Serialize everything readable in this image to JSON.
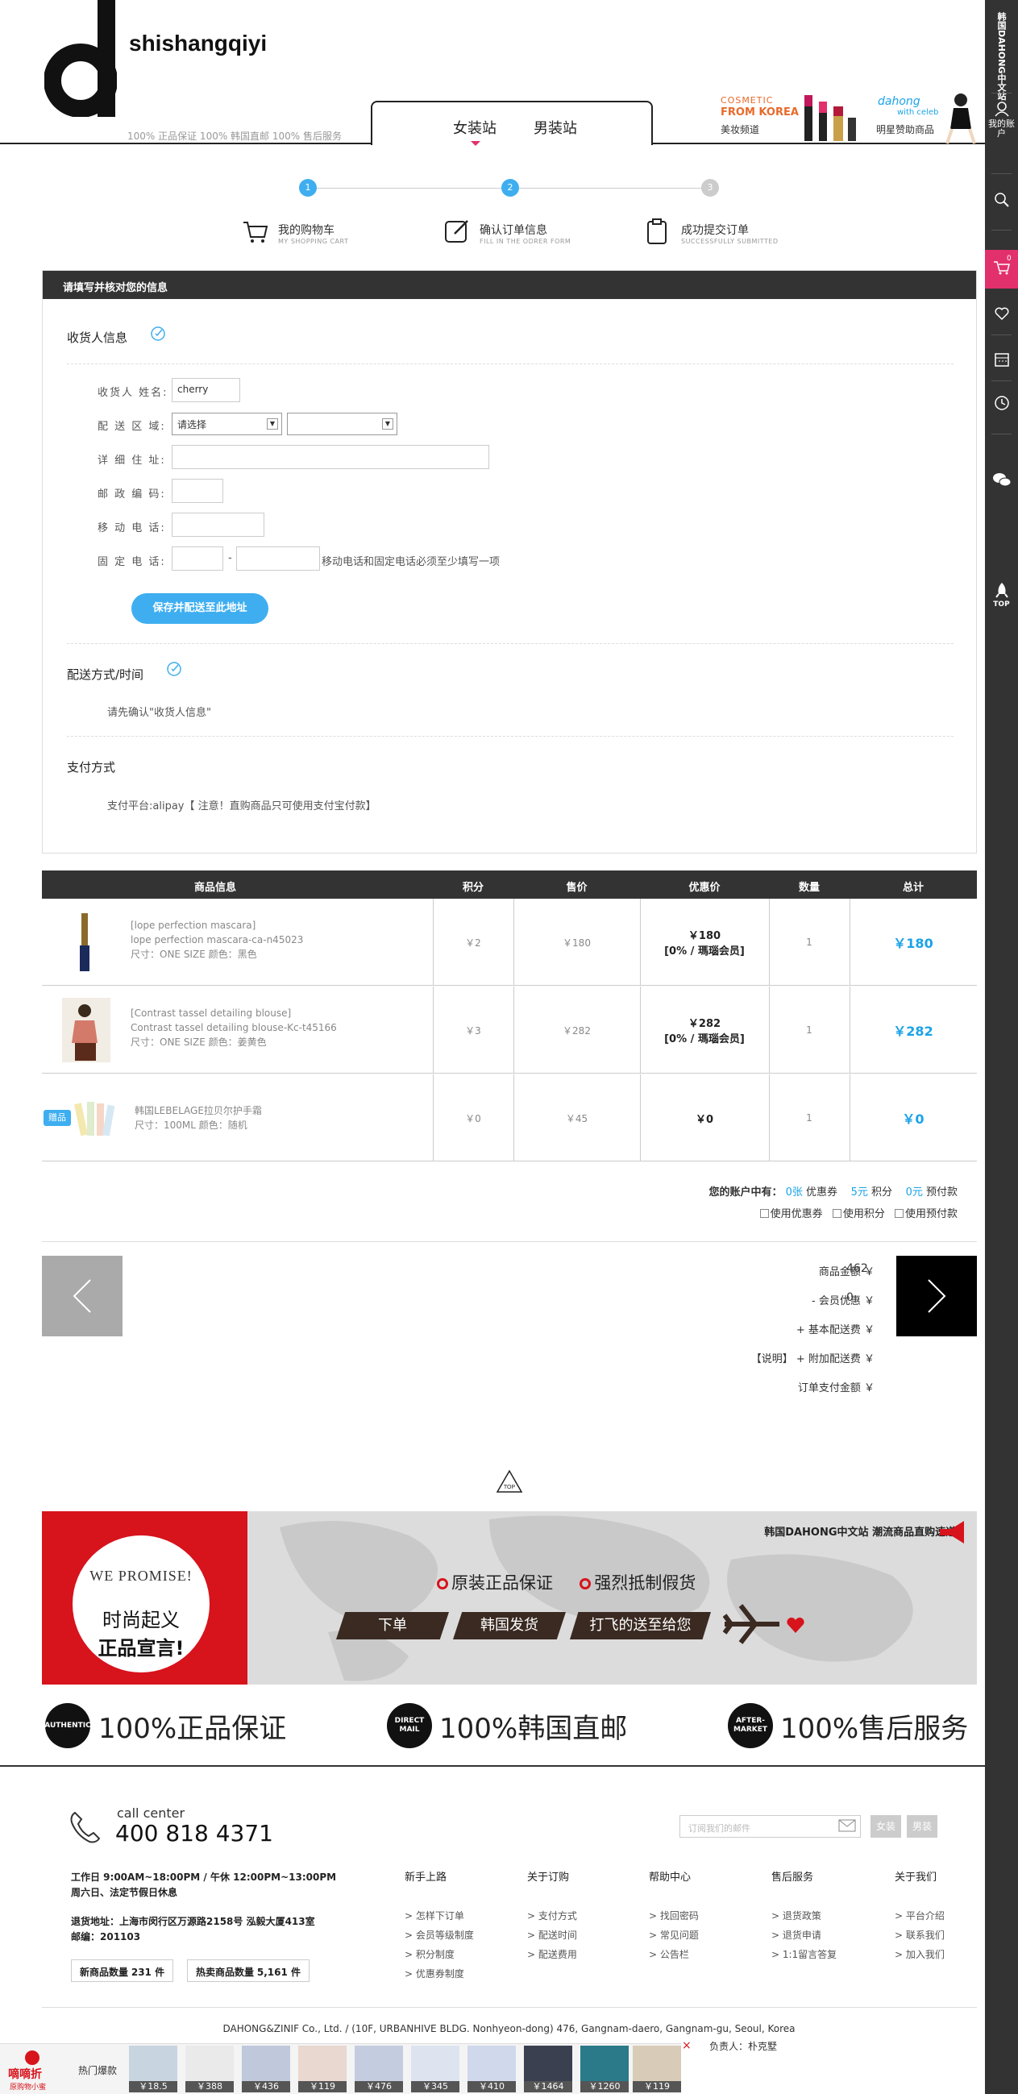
{
  "header": {
    "brand": "shishangqiyi",
    "slogan": "100% 正品保证  100% 韩国直邮  100% 售后服务",
    "tabs": [
      "女装站",
      "男装站"
    ],
    "promo1": {
      "line1": "COSMETIC",
      "line2": "FROM KOREA",
      "line3": "美妆频道"
    },
    "promo2": {
      "line1": "dahong",
      "line2": "with celeb",
      "line3": "明星赞助商品"
    }
  },
  "sidebar": {
    "site_name": "韩国DAHONG中文站",
    "account": "我的账户",
    "cart_count": "0",
    "top": "TOP"
  },
  "steps": [
    {
      "num": "1",
      "label": "我的购物车",
      "sub": "MY SHOPPING CART"
    },
    {
      "num": "2",
      "label": "确认订单信息",
      "sub": "FILL IN THE ODRER FORM"
    },
    {
      "num": "3",
      "label": "成功提交订单",
      "sub": "SUCCESSFULLY SUBMITTED"
    }
  ],
  "form": {
    "panel_title": "请填写并核对您的信息",
    "section_receiver": "收货人信息",
    "name_label": "收货人 姓名:",
    "name_value": "cherry",
    "area_label": "配 送 区 域:",
    "area_select": "请选择",
    "addr_label": "详 细 住 址:",
    "zip_label": "邮 政 编 码:",
    "mobile_label": "移 动 电 话:",
    "phone_label": "固 定 电 话:",
    "phone_dash": "-",
    "phone_note": "移动电话和固定电话必须至少填写一项",
    "save_button": "保存并配送至此地址",
    "section_delivery": "配送方式/时间",
    "delivery_note": "请先确认\"收货人信息\"",
    "section_payment": "支付方式",
    "payment_note": "支付平台:alipay【 注意！直购商品只可使用支付宝付款】"
  },
  "table": {
    "headers": [
      "商品信息",
      "积分",
      "售价",
      "优惠价",
      "数量",
      "总计"
    ],
    "rows": [
      {
        "name1": "[lope perfection mascara]",
        "name2": "lope perfection mascara-ca-n45023",
        "attrs": "尺寸：ONE SIZE    颜色：黑色",
        "points": "￥2",
        "price": "￥180",
        "discount": "￥180",
        "member": "[0% / 瑪瑙会员]",
        "qty": "1",
        "total": "￥180"
      },
      {
        "name1": "[Contrast tassel detailing blouse]",
        "name2": "Contrast tassel detailing blouse-Kc-t45166",
        "attrs": "尺寸：ONE SIZE    颜色：姜黄色",
        "points": "￥3",
        "price": "￥282",
        "discount": "￥282",
        "member": "[0% / 瑪瑙会员]",
        "qty": "1",
        "total": "￥282"
      },
      {
        "badge": "赠品",
        "name1": "韩国LEBELAGE拉贝尔护手霜",
        "attrs": "尺寸：100ML    颜色：随机",
        "points": "￥0",
        "price": "￥45",
        "discount": "￥0",
        "qty": "1",
        "total": "￥0"
      }
    ]
  },
  "account": {
    "prefix": "您的账户中有：",
    "coupon_n": "0张",
    "coupon": "优惠券",
    "points_n": "5元",
    "points": "积分",
    "prepay_n": "0元",
    "prepay": "预付款",
    "opt1": "使用优惠券",
    "opt2": "使用积分",
    "opt3": "使用预付款"
  },
  "summary": {
    "goods_label": "商品金额  ￥",
    "goods_value": "462",
    "member_label": "- 会员优惠  ￥",
    "member_value": "0",
    "base_label": "+ 基本配送费  ￥",
    "extra_label": "【说明】 + 附加配送费  ￥",
    "pay_label": "订单支付金额  ￥"
  },
  "banner": {
    "promise1": "WE PROMISE!",
    "promise2": "时尚起义",
    "promise3": "正品宣言!",
    "point1": "原装正品保证",
    "point2": "强烈抵制假货",
    "step1": "下单",
    "step2": "韩国发货",
    "step3": "打飞的送至给您",
    "tag": "韩国DAHONG中文站  潮流商品直购速递!",
    "top": "TOP"
  },
  "guarantees": [
    {
      "badge": "AUTHENTIC",
      "text": "100%正品保证"
    },
    {
      "badge": "DIRECT MAIL",
      "text": "100%韩国直邮"
    },
    {
      "badge": "AFTER-MARKET",
      "text": "100%售后服务"
    }
  ],
  "footer": {
    "cc_label": "call center",
    "cc_number": "400 818 4371",
    "email_placeholder": "订阅我们的邮件",
    "btn_women": "女装",
    "btn_men": "男装",
    "hours1": "工作日 9:00AM~18:00PM / 午休 12:00PM~13:00PM",
    "hours2": "周六日、法定节假日休息",
    "addr1": "退货地址：上海市闵行区万源路2158号 泓毅大厦413室",
    "addr2": "邮编：201103",
    "new_label": "新商品数量",
    "new_count": "231 件",
    "hot_label": "热卖商品数量",
    "hot_count": "5,161 件",
    "columns": [
      {
        "title": "新手上路",
        "items": [
          "> 怎样下订单",
          "> 会员等级制度",
          "> 积分制度",
          "> 优惠券制度"
        ]
      },
      {
        "title": "关于订购",
        "items": [
          "> 支付方式",
          "> 配送时间",
          "> 配送费用"
        ]
      },
      {
        "title": "帮助中心",
        "items": [
          "> 找回密码",
          "> 常见问题",
          "> 公告栏"
        ]
      },
      {
        "title": "售后服务",
        "items": [
          "> 退货政策",
          "> 退货申请",
          "> 1:1留言答复"
        ]
      },
      {
        "title": "关于我们",
        "items": [
          "> 平台介绍",
          "> 联系我们",
          "> 加入我们"
        ]
      }
    ],
    "copyright": "DAHONG&ZINIF Co., Ltd. / (10F, URBANHIVE BLDG. Nonhyeon-dong) 476, Gangnam-daero, Gangnam-gu, Seoul, Korea",
    "owner": "负责人：朴克墅"
  },
  "bottom_bar": {
    "logo": "嘀嘀折",
    "logo_sub": "原购物小蜜",
    "label": "热门爆款",
    "close": "×",
    "prices": [
      "￥18.5",
      "￥388",
      "￥436",
      "￥119",
      "￥476",
      "￥345",
      "￥410",
      "￥1464",
      "￥1260",
      "￥119"
    ]
  }
}
